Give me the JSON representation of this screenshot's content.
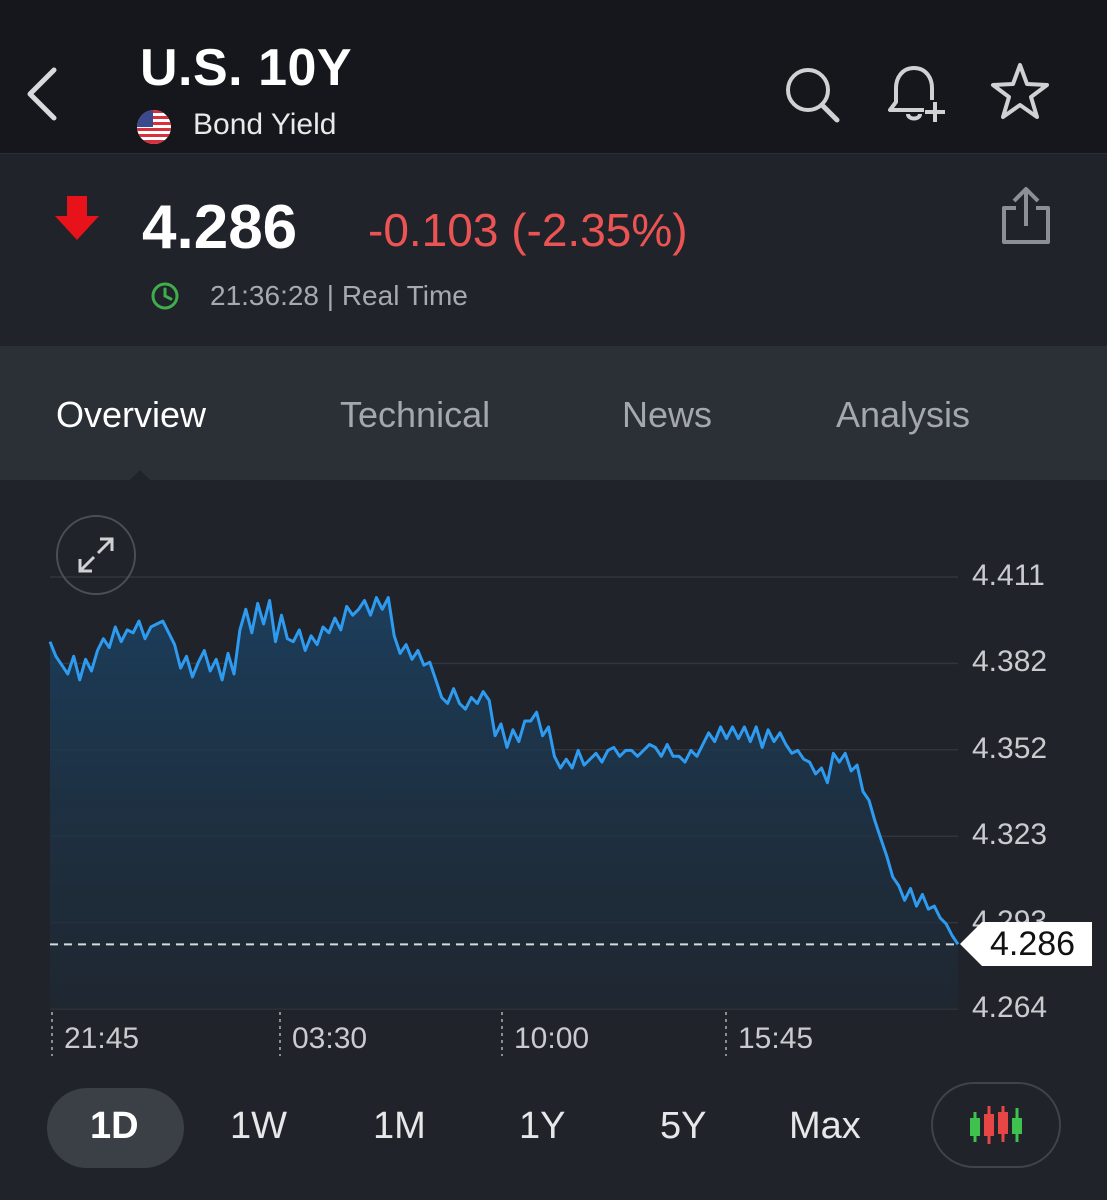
{
  "header": {
    "title": "U.S. 10Y",
    "subtitle": "Bond Yield"
  },
  "quote": {
    "price": "4.286",
    "change": "-0.103 (-2.35%)",
    "time": "21:36:28 | Real Time",
    "down_color": "#ec5454"
  },
  "tabs": [
    {
      "label": "Overview",
      "active": true
    },
    {
      "label": "Technical",
      "active": false
    },
    {
      "label": "News",
      "active": false
    },
    {
      "label": "Analysis",
      "active": false
    }
  ],
  "chart_data": {
    "type": "area",
    "y_ticks": [
      "4.411",
      "4.382",
      "4.352",
      "4.323",
      "4.293",
      "4.264"
    ],
    "x_ticks": [
      "21:45",
      "03:30",
      "10:00",
      "15:45"
    ],
    "ylim": [
      4.264,
      4.411
    ],
    "current_value": 4.286,
    "current_label": "4.286",
    "series": [
      {
        "values": [
          4.389,
          4.384,
          4.381,
          4.378,
          4.384,
          4.376,
          4.383,
          4.379,
          4.386,
          4.39,
          4.387,
          4.394,
          4.389,
          4.393,
          4.392,
          4.396,
          4.39,
          4.394,
          4.395,
          4.396,
          4.392,
          4.388,
          4.38,
          4.384,
          4.377,
          4.382,
          4.386,
          4.379,
          4.383,
          4.376,
          4.385,
          4.378,
          4.393,
          4.4,
          4.392,
          4.402,
          4.395,
          4.403,
          4.389,
          4.398,
          4.39,
          4.389,
          4.393,
          4.386,
          4.391,
          4.388,
          4.394,
          4.392,
          4.397,
          4.393,
          4.401,
          4.398,
          4.4,
          4.403,
          4.398,
          4.404,
          4.4,
          4.404,
          4.391,
          4.385,
          4.388,
          4.383,
          4.386,
          4.381,
          4.382,
          4.376,
          4.37,
          4.368,
          4.373,
          4.368,
          4.366,
          4.37,
          4.368,
          4.372,
          4.369,
          4.357,
          4.361,
          4.353,
          4.359,
          4.355,
          4.362,
          4.362,
          4.365,
          4.357,
          4.36,
          4.35,
          4.346,
          4.349,
          4.346,
          4.352,
          4.347,
          4.349,
          4.351,
          4.348,
          4.352,
          4.353,
          4.35,
          4.352,
          4.352,
          4.35,
          4.352,
          4.354,
          4.353,
          4.35,
          4.354,
          4.35,
          4.35,
          4.348,
          4.352,
          4.35,
          4.354,
          4.358,
          4.355,
          4.36,
          4.356,
          4.36,
          4.356,
          4.36,
          4.355,
          4.36,
          4.353,
          4.359,
          4.355,
          4.358,
          4.354,
          4.351,
          4.352,
          4.349,
          4.348,
          4.344,
          4.346,
          4.341,
          4.351,
          4.348,
          4.351,
          4.345,
          4.347,
          4.338,
          4.335,
          4.328,
          4.322,
          4.316,
          4.309,
          4.306,
          4.301,
          4.305,
          4.299,
          4.303,
          4.298,
          4.299,
          4.295,
          4.293,
          4.289,
          4.286
        ]
      }
    ]
  },
  "ranges": [
    {
      "label": "1D",
      "active": true
    },
    {
      "label": "1W",
      "active": false
    },
    {
      "label": "1M",
      "active": false
    },
    {
      "label": "1Y",
      "active": false
    },
    {
      "label": "5Y",
      "active": false
    },
    {
      "label": "Max",
      "active": false
    }
  ]
}
